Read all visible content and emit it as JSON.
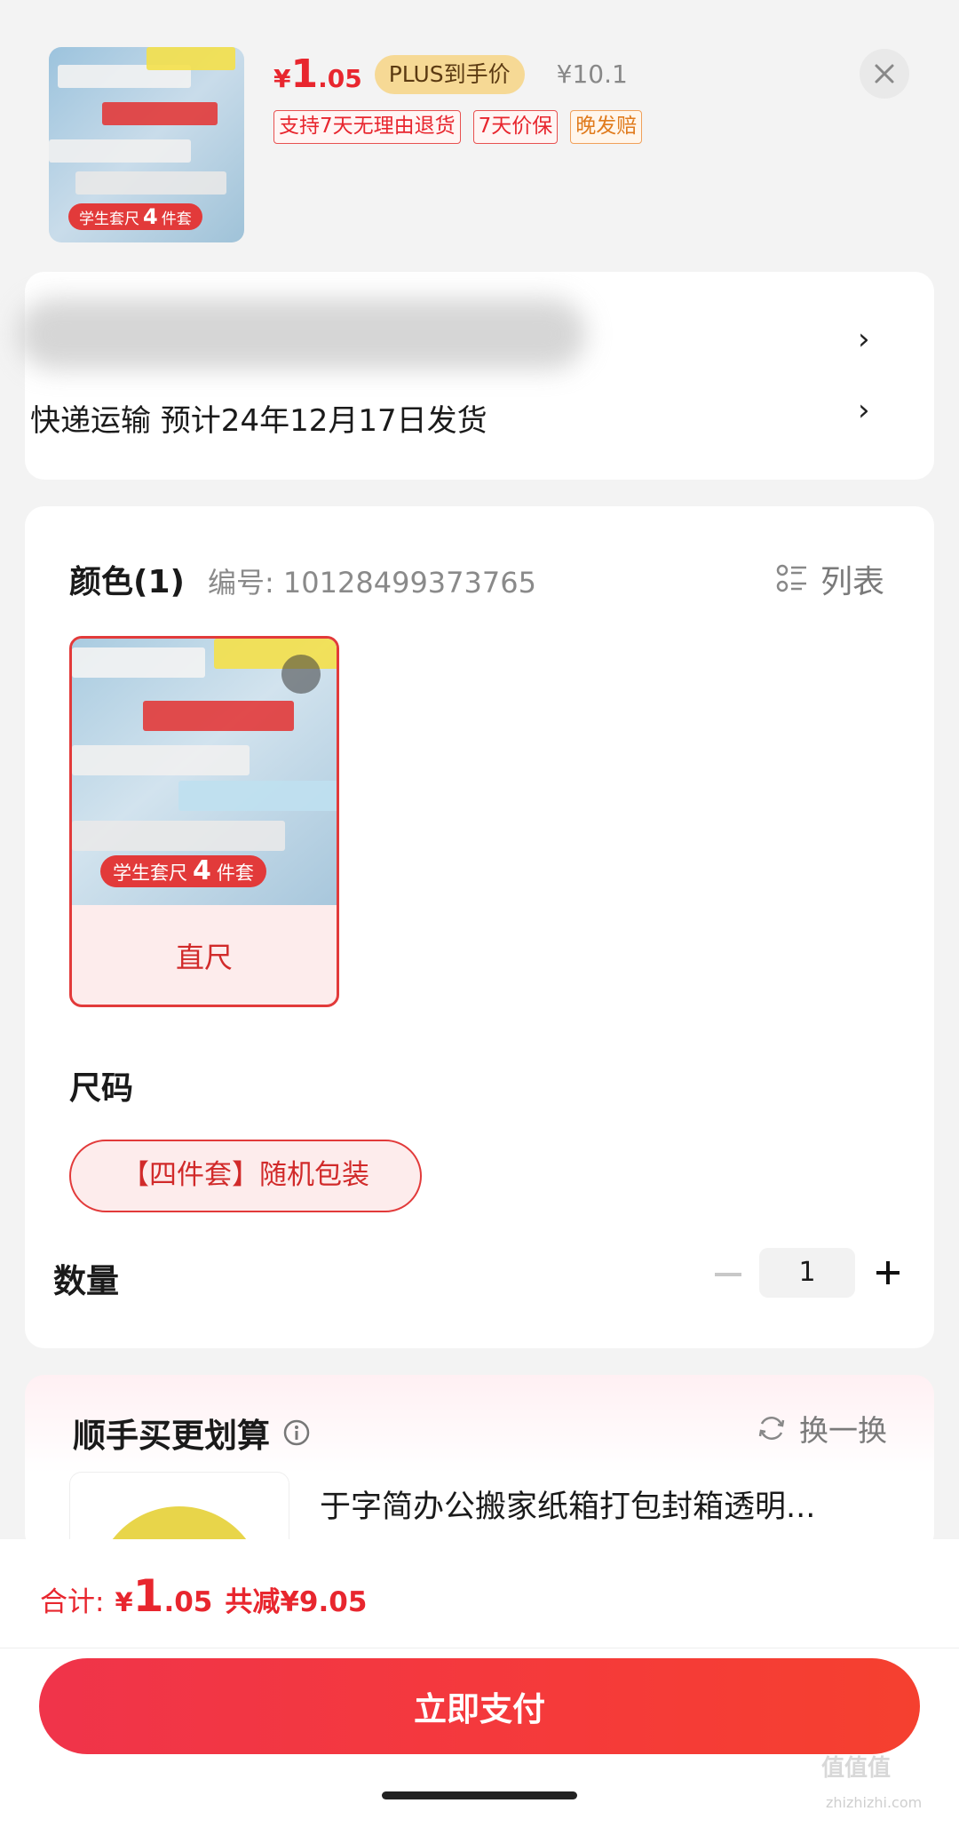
{
  "header": {
    "price_currency": "¥",
    "price_int": "1",
    "price_dec": ".05",
    "plus_label": "PLUS到手价",
    "original_price": "¥10.1",
    "tags": [
      "支持7天无理由退货",
      "7天价保",
      "晚发赔"
    ],
    "thumb_badge_pre": "学生套尺",
    "thumb_badge_num": "4",
    "thumb_badge_post": "件套"
  },
  "address": {
    "shipping_text": "快递运输 预计24年12月17日发货"
  },
  "color": {
    "title": "颜色(1)",
    "sku_number": "编号: 10128499373765",
    "list_label": "列表",
    "option_label": "直尺",
    "option_badge_pre": "学生套尺",
    "option_badge_num": "4",
    "option_badge_post": "件套"
  },
  "size": {
    "title": "尺码",
    "option_label": "【四件套】随机包装"
  },
  "quantity": {
    "label": "数量",
    "value": "1"
  },
  "upsell": {
    "title": "顺手买更划算",
    "refresh_label": "换一换",
    "product_name": "于字简办公搬家纸箱打包封箱透明..."
  },
  "footer": {
    "total_label": "合计:",
    "total_currency": "¥",
    "total_int": "1",
    "total_dec": ".05",
    "discount_text": "共减¥9.05",
    "pay_button": "立即支付"
  },
  "watermark": {
    "title": "值值值",
    "url": "zhizhizhi.com"
  },
  "colors": {
    "accent_red": "#e8262e",
    "plus_gold": "#f6d995",
    "orange_tag": "#e07b1d"
  }
}
